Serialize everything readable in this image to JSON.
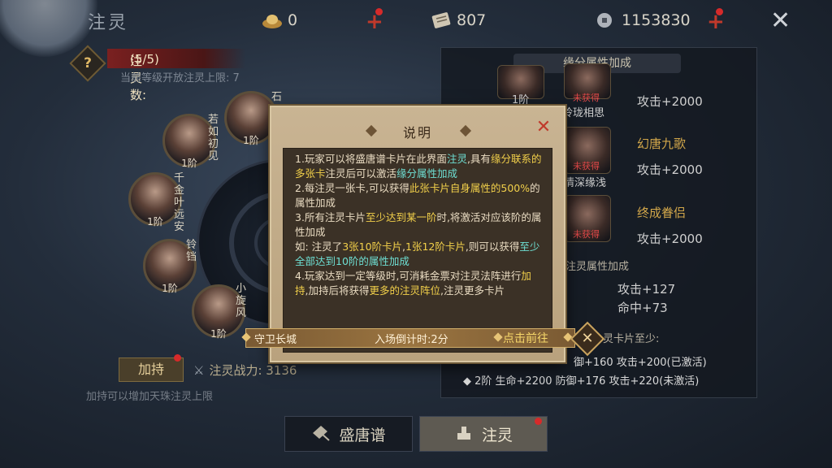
{
  "header": {
    "title": "注灵",
    "ingot": "0",
    "scroll": "807",
    "coins": "1153830",
    "plus_symbol": "+"
  },
  "left": {
    "help_label": "?",
    "count_label": "注灵数:",
    "count_value": "(5/5)",
    "limit_text": "当前等级开放注灵上限: 7",
    "cards": [
      {
        "name": "若如初见",
        "level": "1阶"
      },
      {
        "name": "千金叶远安",
        "level": "1阶"
      },
      {
        "name": "铃铛",
        "level": "1阶"
      },
      {
        "name": "小旋风",
        "level": "1阶"
      },
      {
        "name": "石",
        "level": "1阶"
      }
    ],
    "jiachi_button": "加持",
    "power_text": "注灵战力: 3136",
    "hint": "加持可以增加天珠注灵上限"
  },
  "right": {
    "header": "缘分属性加成",
    "top_level": "1阶",
    "bonds": [
      {
        "name": "玲珑相思",
        "status": "未获得",
        "attr": "攻击+2000"
      },
      {
        "name": "幻唐九歌",
        "caption": "情深缘浅",
        "status": "未获得",
        "attr": "攻击+2000"
      },
      {
        "name": "终成眷侣",
        "status": "未获得",
        "attr": "攻击+2000"
      }
    ],
    "section2": "注灵属性加成",
    "attrs": [
      "攻击+127",
      "命中+73"
    ],
    "section3_suffix": "灵卡片至少:",
    "row1": "御+160 攻击+200(已激活)",
    "row2_prefix": "2阶 生命+2200 防御+176 攻击+220(未激活)"
  },
  "dialog": {
    "title": "说明",
    "close": "✕",
    "lines": {
      "l1a": "1.玩家可以将盛唐谱卡片在此界面",
      "l1b": "注灵",
      "l1c": ",具有",
      "l1d": "缘分联系的多张卡",
      "l1e": "注灵后可以激活",
      "l1f": "缘分属性加成",
      "l2a": "2.每注灵一张卡,可以获得",
      "l2b": "此张卡片自身属性的500%",
      "l2c": "的属性加成",
      "l3a": "3.所有注灵卡片",
      "l3b": "至少达到某一阶",
      "l3c": "时,将激活对应该阶的属性加成",
      "l4a": "如: 注灵了",
      "l4b": "3张10阶卡片",
      "l4c": ",",
      "l4d": "1张12阶卡片",
      "l4e": ",则可以获得",
      "l4f": "至少全部达到10阶的属性加成",
      "l5a": "4.玩家达到一定等级时,可消耗金票对注灵法阵进行",
      "l5b": "加持",
      "l5c": ",加持后将获得",
      "l5d": "更多的注灵阵位",
      "l5e": ",注灵更多卡片"
    }
  },
  "banner": {
    "place": "守卫长城",
    "countdown": "入场倒计时:2分",
    "go": "点击前往",
    "close": "✕"
  },
  "tabs": {
    "tab1": "盛唐谱",
    "tab2": "注灵"
  },
  "colors": {
    "accent_yellow": "#f2d04a",
    "accent_cyan": "#6ee0d4",
    "red": "#d62a2a"
  }
}
